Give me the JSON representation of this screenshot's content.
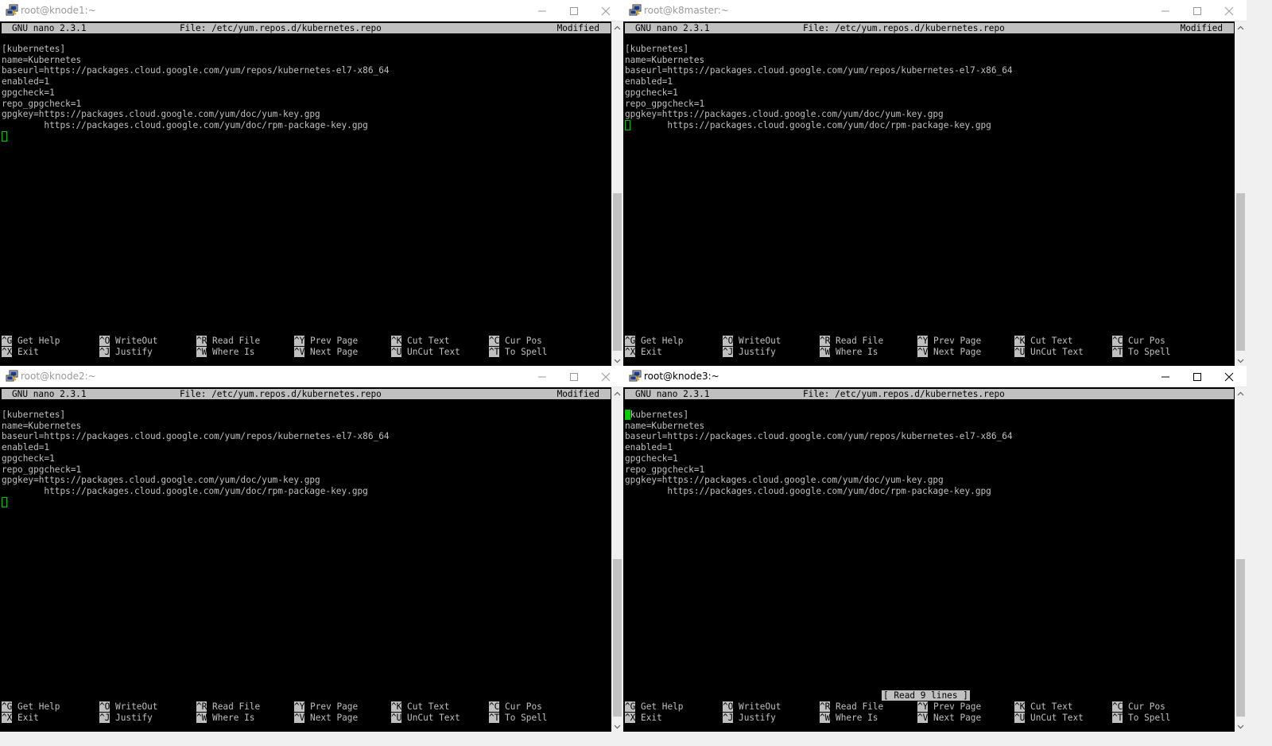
{
  "windows": [
    {
      "id": "knode1",
      "title": "root@knode1:~",
      "active": false,
      "nano_version": "GNU nano 2.3.1",
      "file_label": "File: /etc/yum.repos.d/kubernetes.repo",
      "modified": "Modified",
      "cursor_row": 8,
      "cursor_col": 0,
      "status_message": ""
    },
    {
      "id": "k8master",
      "title": "root@k8master:~",
      "active": false,
      "nano_version": "GNU nano 2.3.1",
      "file_label": "File: /etc/yum.repos.d/kubernetes.repo",
      "modified": "Modified",
      "cursor_row": 7,
      "cursor_col": 0,
      "status_message": ""
    },
    {
      "id": "knode2",
      "title": "root@knode2:~",
      "active": false,
      "nano_version": "GNU nano 2.3.1",
      "file_label": "File: /etc/yum.repos.d/kubernetes.repo",
      "modified": "Modified",
      "cursor_row": 8,
      "cursor_col": 0,
      "status_message": ""
    },
    {
      "id": "knode3",
      "title": "root@knode3:~",
      "active": true,
      "nano_version": "GNU nano 2.3.1",
      "file_label": "File: /etc/yum.repos.d/kubernetes.repo",
      "modified": "",
      "cursor_row": 0,
      "cursor_col": 0,
      "status_message": "[ Read 9 lines ]"
    }
  ],
  "file_lines": [
    "[kubernetes]",
    "name=Kubernetes",
    "baseurl=https://packages.cloud.google.com/yum/repos/kubernetes-el7-x86_64",
    "enabled=1",
    "gpgcheck=1",
    "repo_gpgcheck=1",
    "gpgkey=https://packages.cloud.google.com/yum/doc/yum-key.gpg",
    "        https://packages.cloud.google.com/yum/doc/rpm-package-key.gpg"
  ],
  "shortcuts": [
    [
      {
        "key": "^G",
        "label": "Get Help"
      },
      {
        "key": "^O",
        "label": "WriteOut"
      },
      {
        "key": "^R",
        "label": "Read File"
      },
      {
        "key": "^Y",
        "label": "Prev Page"
      },
      {
        "key": "^K",
        "label": "Cut Text"
      },
      {
        "key": "^C",
        "label": "Cur Pos"
      }
    ],
    [
      {
        "key": "^X",
        "label": "Exit"
      },
      {
        "key": "^J",
        "label": "Justify"
      },
      {
        "key": "^W",
        "label": "Where Is"
      },
      {
        "key": "^V",
        "label": "Next Page"
      },
      {
        "key": "^U",
        "label": "UnCut Text"
      },
      {
        "key": "^T",
        "label": "To Spell"
      }
    ]
  ],
  "colors": {
    "terminal_bg": "#000000",
    "terminal_fg": "#c0c0c0",
    "cursor": "#00d000",
    "header_bg": "#c0c0c0"
  },
  "icons": {
    "app": "putty-icon",
    "minimize": "minimize-icon",
    "maximize": "maximize-icon",
    "close": "close-icon"
  }
}
